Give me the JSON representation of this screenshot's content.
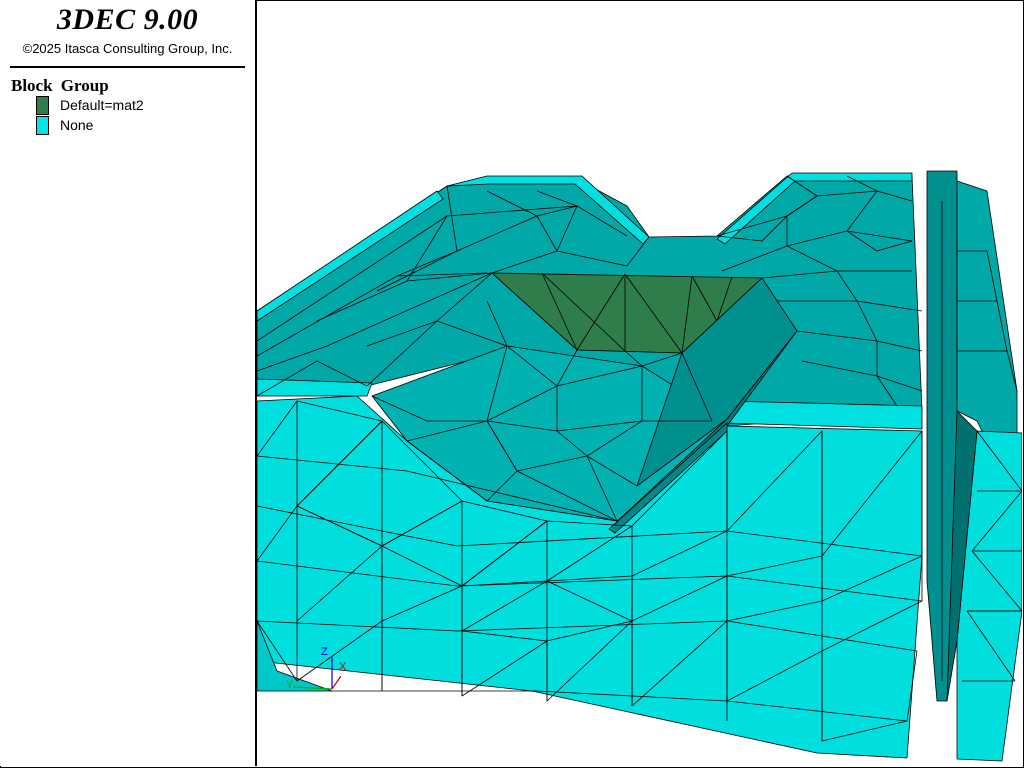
{
  "legend": {
    "title": "3DEC 9.00",
    "copyright": "©2025 Itasca Consulting Group, Inc.",
    "heading": "Block  Group",
    "entries": [
      {
        "label": "Default=mat2",
        "color": "#2e7d4a"
      },
      {
        "label": "None",
        "color": "#00e5e5"
      }
    ]
  },
  "axes": {
    "z": "Z",
    "x": "X",
    "y": "Y"
  },
  "colors": {
    "side_face": "#00dede",
    "top_face": "#00a8a8",
    "dark_face": "#007a7a",
    "mat2": "#2e7d4a",
    "edge": "#000000"
  }
}
